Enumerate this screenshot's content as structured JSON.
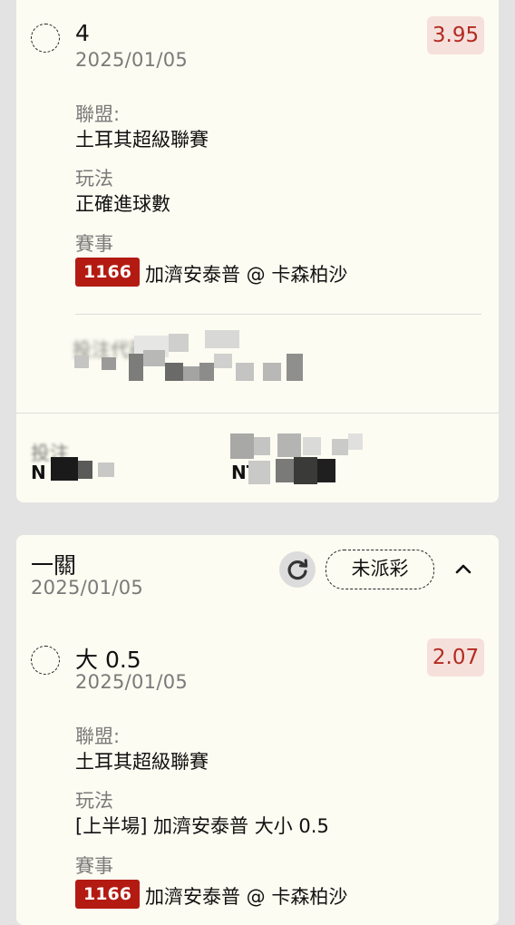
{
  "bet1": {
    "selection": "4",
    "date": "2025/01/05",
    "odds": "3.95",
    "league_label": "聯盟:",
    "league": "土耳其超級聯賽",
    "play_label": "玩法",
    "play": "正確進球數",
    "event_label": "賽事",
    "event_no": "1166",
    "event_name": "加濟安泰普 @ 卡森柏沙",
    "bet_code_label": "投注代碼",
    "footer_left_label": "投注",
    "footer_left_value": "N",
    "footer_right_value": "NT"
  },
  "group": {
    "title": "一關",
    "date": "2025/01/05",
    "status": "未派彩"
  },
  "bet2": {
    "selection": "大 0.5",
    "date": "2025/01/05",
    "odds": "2.07",
    "league_label": "聯盟:",
    "league": "土耳其超級聯賽",
    "play_label": "玩法",
    "play": "[上半場] 加濟安泰普 大小 0.5",
    "event_label": "賽事",
    "event_no": "1166",
    "event_name": "加濟安泰普 @ 卡森柏沙"
  },
  "icons": {
    "refresh": "refresh-icon",
    "chevron": "chevron-up-icon",
    "radio": "unchecked-circle-icon"
  },
  "colors": {
    "card_bg": "#fdfcf2",
    "page_bg": "#e3e3e3",
    "odds_bg": "#f6e0dc",
    "odds_text": "#b32c22",
    "badge_red": "#b31b12"
  }
}
